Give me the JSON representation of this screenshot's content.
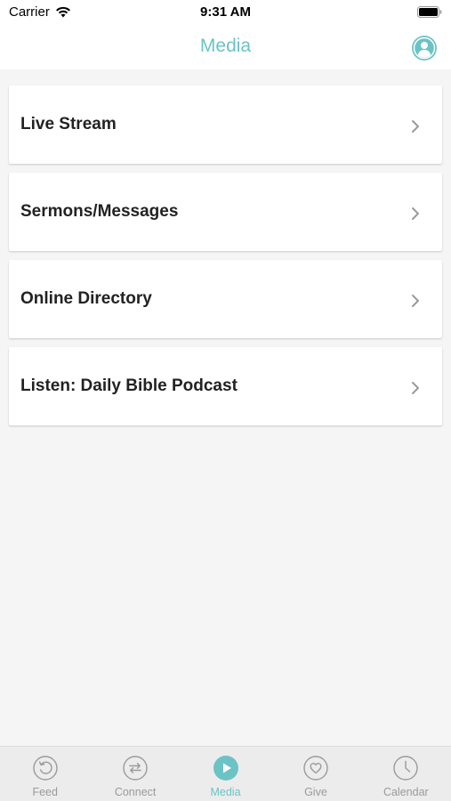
{
  "status_bar": {
    "carrier": "Carrier",
    "time": "9:31 AM"
  },
  "nav": {
    "title": "Media",
    "profile_icon": "user-avatar-icon"
  },
  "items": [
    {
      "label": "Live Stream"
    },
    {
      "label": "Sermons/Messages"
    },
    {
      "label": "Online Directory"
    },
    {
      "label": "Listen: Daily Bible Podcast"
    }
  ],
  "tabs": [
    {
      "label": "Feed",
      "icon": "refresh-circle-icon",
      "active": false
    },
    {
      "label": "Connect",
      "icon": "swap-arrows-icon",
      "active": false
    },
    {
      "label": "Media",
      "icon": "play-circle-icon",
      "active": true
    },
    {
      "label": "Give",
      "icon": "heart-circle-icon",
      "active": false
    },
    {
      "label": "Calendar",
      "icon": "clock-icon",
      "active": false
    }
  ],
  "colors": {
    "accent": "#6cc3c6",
    "inactive": "#9a9a9a",
    "background": "#f5f5f5"
  }
}
